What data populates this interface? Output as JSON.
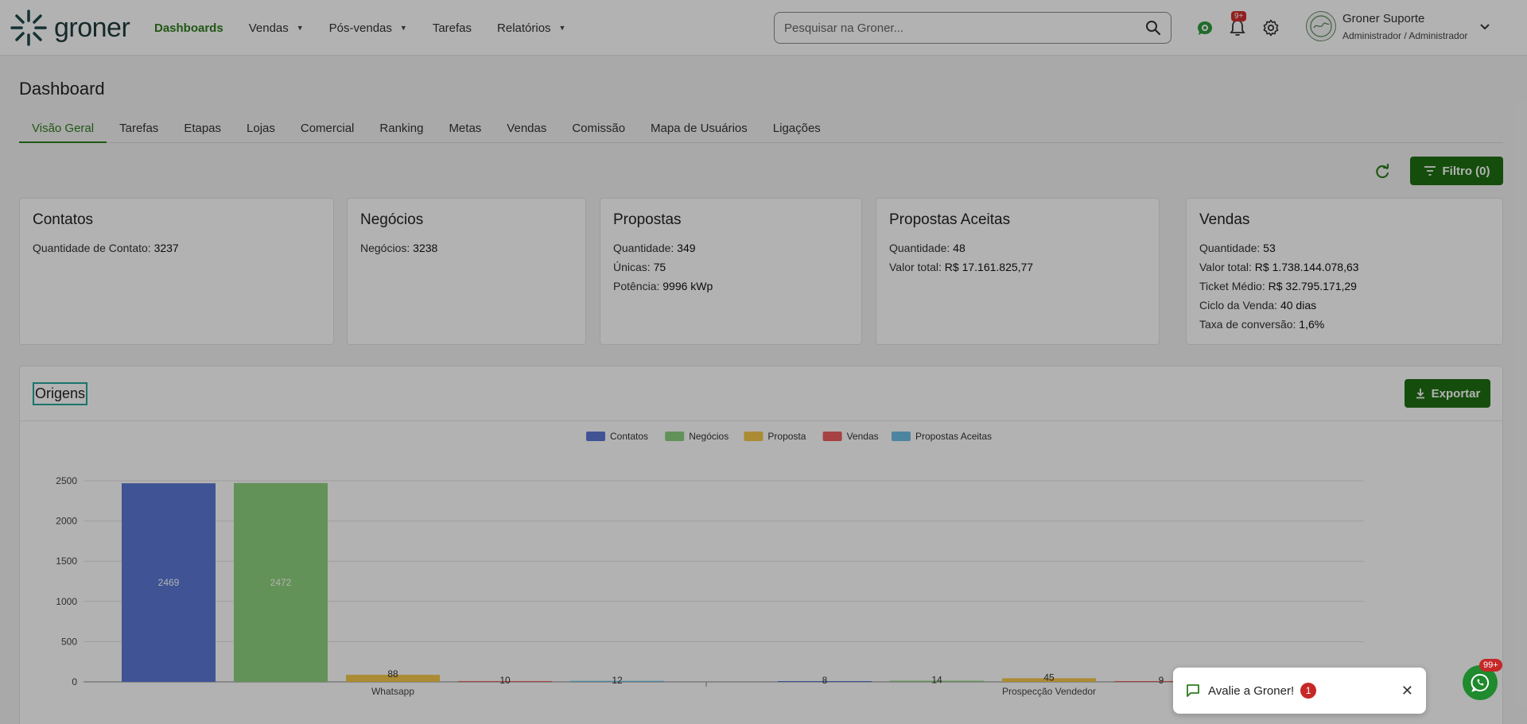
{
  "brand": {
    "name": "groner"
  },
  "nav": {
    "items": [
      {
        "label": "Dashboards",
        "active": true,
        "dropdown": false
      },
      {
        "label": "Vendas",
        "active": false,
        "dropdown": true
      },
      {
        "label": "Pós-vendas",
        "active": false,
        "dropdown": true
      },
      {
        "label": "Tarefas",
        "active": false,
        "dropdown": false
      },
      {
        "label": "Relatórios",
        "active": false,
        "dropdown": true
      }
    ]
  },
  "search": {
    "placeholder": "Pesquisar na Groner..."
  },
  "notifications": {
    "badge": "9+"
  },
  "user": {
    "name": "Groner Suporte",
    "role": "Administrador / Administrador"
  },
  "page": {
    "title": "Dashboard"
  },
  "tabs": [
    "Visão Geral",
    "Tarefas",
    "Etapas",
    "Lojas",
    "Comercial",
    "Ranking",
    "Metas",
    "Vendas",
    "Comissão",
    "Mapa de Usuários",
    "Ligações"
  ],
  "active_tab": "Visão Geral",
  "filter": {
    "label": "Filtro (0)"
  },
  "cards": [
    {
      "title": "Contatos",
      "rows": [
        {
          "label": "Quantidade de Contato: ",
          "value": "3237"
        }
      ]
    },
    {
      "title": "Negócios",
      "rows": [
        {
          "label": "Negócios: ",
          "value": "3238"
        }
      ]
    },
    {
      "title": "Propostas",
      "rows": [
        {
          "label": "Quantidade: ",
          "value": "349"
        },
        {
          "label": "Únicas: ",
          "value": "75"
        },
        {
          "label": "Potência: ",
          "value": "9996 kWp"
        }
      ]
    },
    {
      "title": "Propostas Aceitas",
      "rows": [
        {
          "label": "Quantidade: ",
          "value": "48"
        },
        {
          "label": "Valor total: ",
          "value": "R$ 17.161.825,77"
        }
      ]
    },
    {
      "title": "Vendas",
      "rows": [
        {
          "label": "Quantidade: ",
          "value": "53"
        },
        {
          "label": "Valor total: ",
          "value": "R$ 1.738.144.078,63"
        },
        {
          "label": "Ticket Médio: ",
          "value": "R$ 32.795.171,29"
        },
        {
          "label": "Ciclo da Venda: ",
          "value": "40 dias"
        },
        {
          "label": "Taxa de conversão: ",
          "value": "1,6%"
        }
      ]
    }
  ],
  "origins": {
    "title": "Origens",
    "export_label": "Exportar"
  },
  "chart_data": {
    "type": "bar",
    "categories": [
      "Whatsapp",
      "Prospecção Vendedor"
    ],
    "series": [
      {
        "name": "Contatos",
        "color": "#5b78d6",
        "values": [
          2469,
          8
        ]
      },
      {
        "name": "Negócios",
        "color": "#8ed27e",
        "values": [
          2472,
          14
        ]
      },
      {
        "name": "Proposta",
        "color": "#f5c84a",
        "values": [
          88,
          45
        ]
      },
      {
        "name": "Vendas",
        "color": "#ee5f5f",
        "values": [
          10,
          9
        ]
      },
      {
        "name": "Propostas Aceitas",
        "color": "#6fbfe6",
        "values": [
          12,
          null
        ]
      }
    ],
    "yticks": [
      0,
      500,
      1000,
      1500,
      2000,
      2500
    ],
    "ylim": [
      0,
      2500
    ],
    "grid": true,
    "legend": "top-center"
  },
  "toast": {
    "text": "Avalie a Groner!",
    "count": "1"
  },
  "whatsapp": {
    "badge": "99+"
  },
  "colors": {
    "brand_green": "#2e7d1e",
    "button_green": "#1f6f13"
  }
}
